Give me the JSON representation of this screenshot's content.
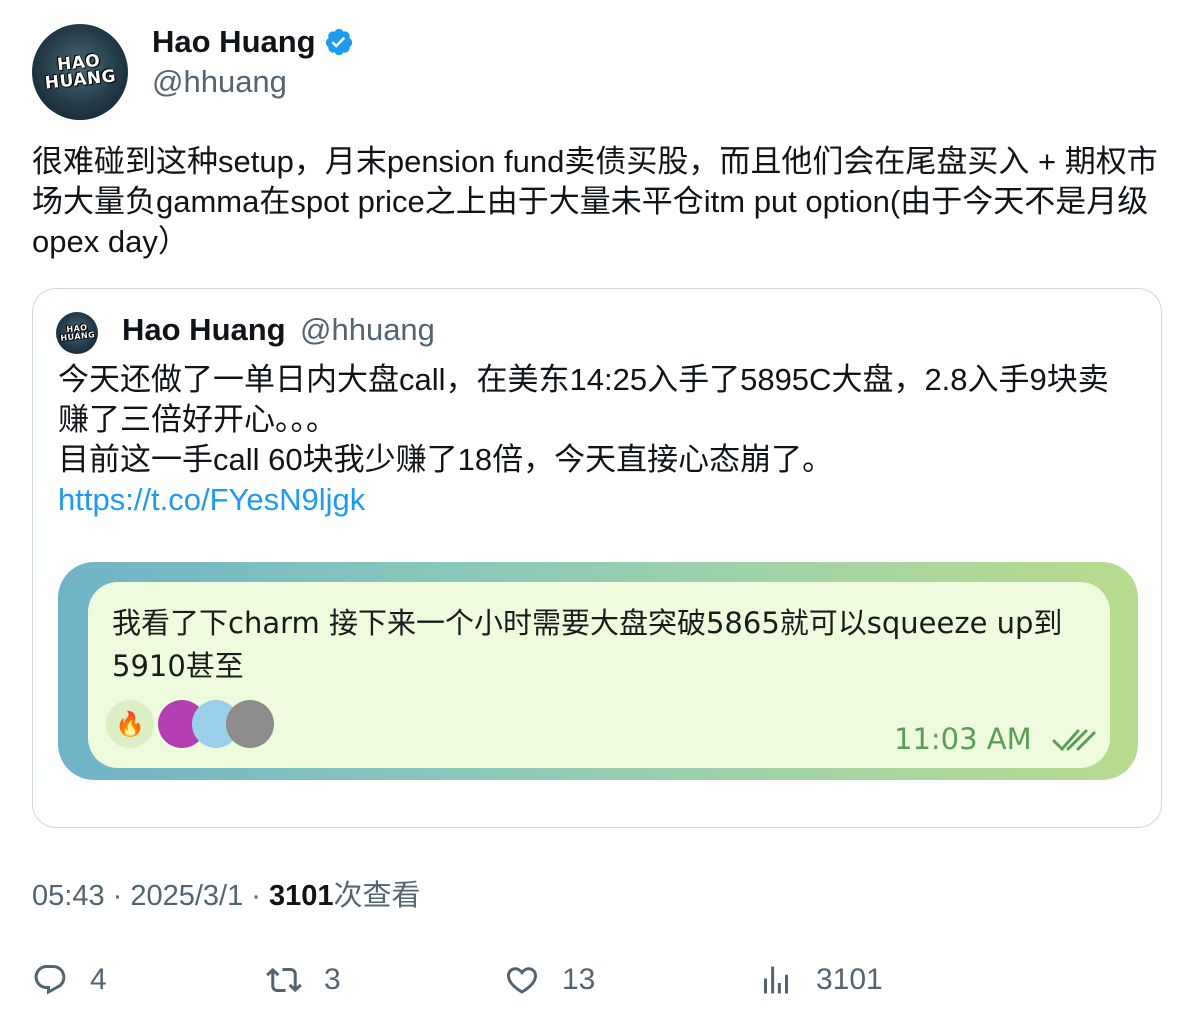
{
  "author": {
    "name": "Hao Huang",
    "handle": "@hhuang",
    "avatar_text": "HAO\nHUANG",
    "verified_icon": "verified-badge-icon"
  },
  "tweet": {
    "text": "很难碰到这种setup，月末pension fund卖债买股，而且他们会在尾盘买入 + 期权市场大量负gamma在spot price之上由于大量未平仓itm put option(由于今天不是月级opex day）"
  },
  "quote": {
    "name": "Hao Huang",
    "handle": "@hhuang",
    "lines": [
      "今天还做了一单日内大盘call，在美东14:25入手了5895C大盘，2.8入手9块卖赚了三倍好开心。。。",
      "目前这一手call 60块我少赚了18倍，今天直接心态崩了。"
    ],
    "link": "https://t.co/FYesN9ljgk",
    "media": {
      "message": "我看了下charm 接下来一个小时需要大盘突破5865就可以squeeze up到5910甚至",
      "reactions": [
        "🔥",
        "sticker",
        "sticker",
        "sticker"
      ],
      "time": "11:03 AM"
    }
  },
  "meta": {
    "time": "05:43",
    "sep1": " · ",
    "date": "2025/3/1",
    "sep2": " · ",
    "views": "3101",
    "views_label": "次查看"
  },
  "actions": {
    "replies": "4",
    "retweets": "3",
    "likes": "13",
    "views": "3101"
  },
  "colors": {
    "link": "#1d9bf0",
    "secondary": "#536471",
    "verified": "#1d9bf0",
    "border": "#cfd9de"
  }
}
